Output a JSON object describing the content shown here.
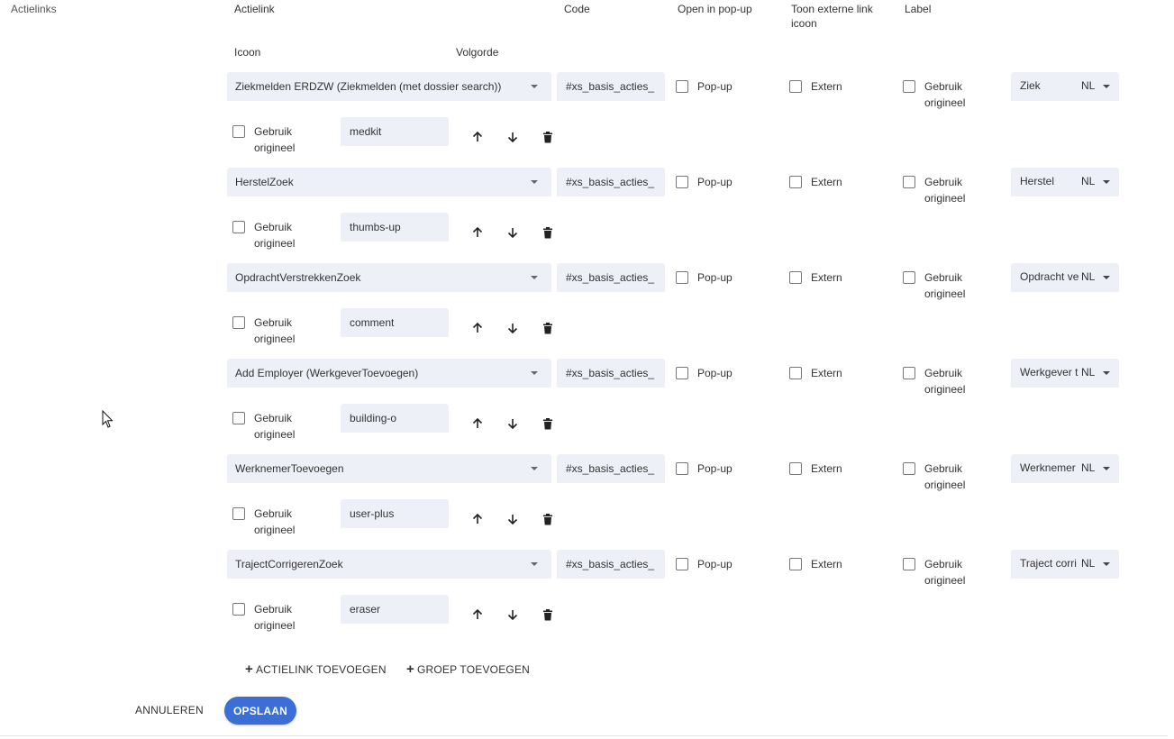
{
  "section": {
    "title": "Actielinks"
  },
  "headers": {
    "actielink": "Actielink",
    "code": "Code",
    "popup": "Open in pop-up",
    "external_line1": "Toon externe link",
    "external_line2": "icoon",
    "label": "Label",
    "icon": "Icoon",
    "order": "Volgorde"
  },
  "common": {
    "popup_label": "Pop-up",
    "external_label": "Extern",
    "use_original_line1": "Gebruik",
    "use_original_line2": "origineel",
    "language": "NL"
  },
  "rows": [
    {
      "actielink": "Ziekmelden ERDZW (Ziekmelden (met dossier search))",
      "code": "#xs_basis_acties_",
      "label": "Ziek",
      "icon": "medkit"
    },
    {
      "actielink": "HerstelZoek",
      "code": "#xs_basis_acties_",
      "label": "Herstel",
      "icon": "thumbs-up"
    },
    {
      "actielink": "OpdrachtVerstrekkenZoek",
      "code": "#xs_basis_acties_",
      "label": "Opdracht ve",
      "icon": "comment"
    },
    {
      "actielink": "Add Employer (WerkgeverToevoegen)",
      "code": "#xs_basis_acties_",
      "label": "Werkgever t",
      "icon": "building-o"
    },
    {
      "actielink": "WerknemerToevoegen",
      "code": "#xs_basis_acties_",
      "label": "Werknemer",
      "icon": "user-plus"
    },
    {
      "actielink": "TrajectCorrigerenZoek",
      "code": "#xs_basis_acties_",
      "label": "Traject corri",
      "icon": "eraser"
    }
  ],
  "actions": {
    "add_actielink": "ACTIELINK TOEVOEGEN",
    "add_group": "GROEP TOEVOEGEN",
    "cancel": "ANNULEREN",
    "save": "OPSLAAN"
  },
  "colors": {
    "primary": "#3b6fd6",
    "field_bg": "#eef0f8"
  }
}
